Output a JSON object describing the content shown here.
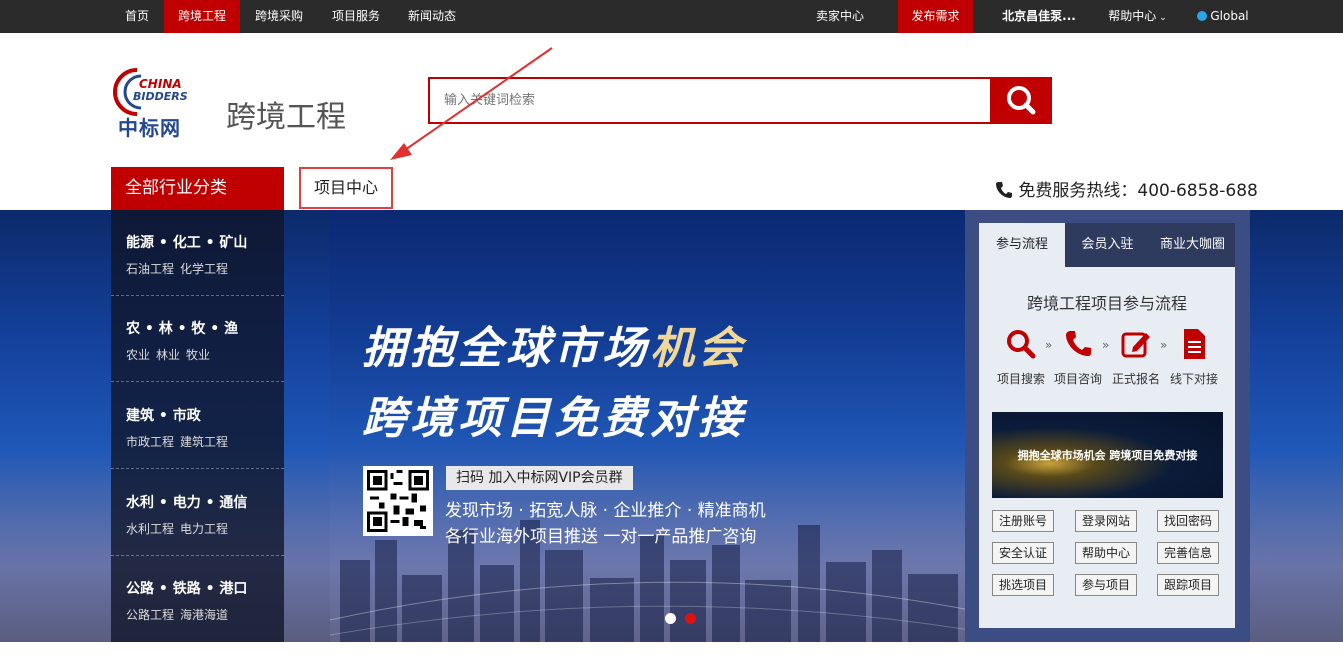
{
  "topbar": {
    "left_items": [
      "首页",
      "跨境工程",
      "跨境采购",
      "项目服务",
      "新闻动态"
    ],
    "seller_center": "卖家中心",
    "post_demand": "发布需求",
    "company": "北京昌佳泵...",
    "help": "帮助中心",
    "global": "Global",
    "accent_color": "#c00000"
  },
  "header": {
    "logo_top": "CHINA",
    "logo_bottom": "BIDDERS",
    "logo_cn": "中标网",
    "page_title": "跨境工程",
    "search_placeholder": "输入关键词检索"
  },
  "nav": {
    "all_categories": "全部行业分类",
    "project_center": "项目中心",
    "hotline": "免费服务热线：400-6858-688"
  },
  "categories": [
    {
      "title": "能源 • 化工 • 矿山",
      "subs": [
        "石油工程",
        "化学工程"
      ]
    },
    {
      "title": "农 • 林 • 牧 • 渔",
      "subs": [
        "农业",
        "林业",
        "牧业"
      ]
    },
    {
      "title": "建筑 • 市政",
      "subs": [
        "市政工程",
        "建筑工程"
      ]
    },
    {
      "title": "水利 • 电力 • 通信",
      "subs": [
        "水利工程",
        "电力工程"
      ]
    },
    {
      "title": "公路 • 铁路 • 港口",
      "subs": [
        "公路工程",
        "海港海道"
      ]
    }
  ],
  "banner": {
    "slogan1_a": "拥抱全球市场",
    "slogan1_b": "机会",
    "slogan2": "跨境项目免费对接",
    "qr_label": "扫码 加入中标网VIP会员群",
    "line1": "发现市场 · 拓宽人脉 · 企业推介 · 精准商机",
    "line2": "各行业海外项目推送  一对一产品推广咨询"
  },
  "panel": {
    "tabs": [
      "参与流程",
      "会员入驻",
      "商业大咖圈"
    ],
    "process_title": "跨境工程项目参与流程",
    "steps": [
      "项目搜索",
      "项目咨询",
      "正式报名",
      "线下对接"
    ],
    "mini_banner": "拥抱全球市场机会 跨境项目免费对接",
    "buttons": [
      "注册账号",
      "登录网站",
      "找回密码",
      "安全认证",
      "帮助中心",
      "完善信息",
      "挑选项目",
      "参与项目",
      "跟踪项目"
    ]
  }
}
